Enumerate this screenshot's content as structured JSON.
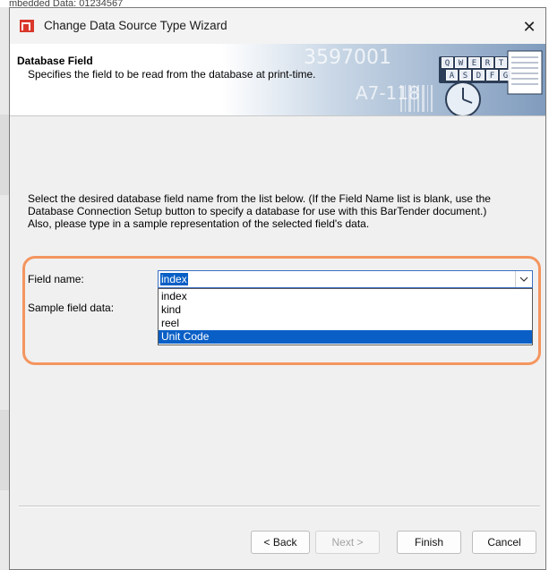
{
  "background": {
    "top_text": "mbedded Data: 01234567"
  },
  "dialog": {
    "title": "Change Data Source Type Wizard",
    "close_glyph": "✕",
    "app_icon": "bartender-icon"
  },
  "banner": {
    "title": "Database Field",
    "subtitle": "Specifies the field to be read from the database at print-time.",
    "art_text_1": "3597001",
    "art_text_2": "A7-118",
    "keys_row1": [
      "Q",
      "W",
      "E",
      "R",
      "T"
    ],
    "keys_row2": [
      "A",
      "S",
      "D",
      "F",
      "G"
    ]
  },
  "instructions": {
    "line1": "Select the desired database field name from the list below. (If the Field Name list is blank, use the Database Connection Setup button to specify a database for use with this BarTender document.)",
    "line2": "Also, please type in a sample representation of the selected field's data."
  },
  "form": {
    "field_name_label": "Field name:",
    "sample_label": "Sample field data:",
    "field_name_value": "index",
    "dropdown_icon": "chevron-down-icon",
    "options": [
      "index",
      "kind",
      "reel",
      "Unit Code"
    ],
    "highlighted_option": "Unit Code"
  },
  "buttons": {
    "back": "< Back",
    "next": "Next >",
    "finish": "Finish",
    "cancel": "Cancel"
  },
  "colors": {
    "selection": "#0a5fc6",
    "highlight_ring": "#f4955f",
    "brand_red": "#d9382c"
  }
}
